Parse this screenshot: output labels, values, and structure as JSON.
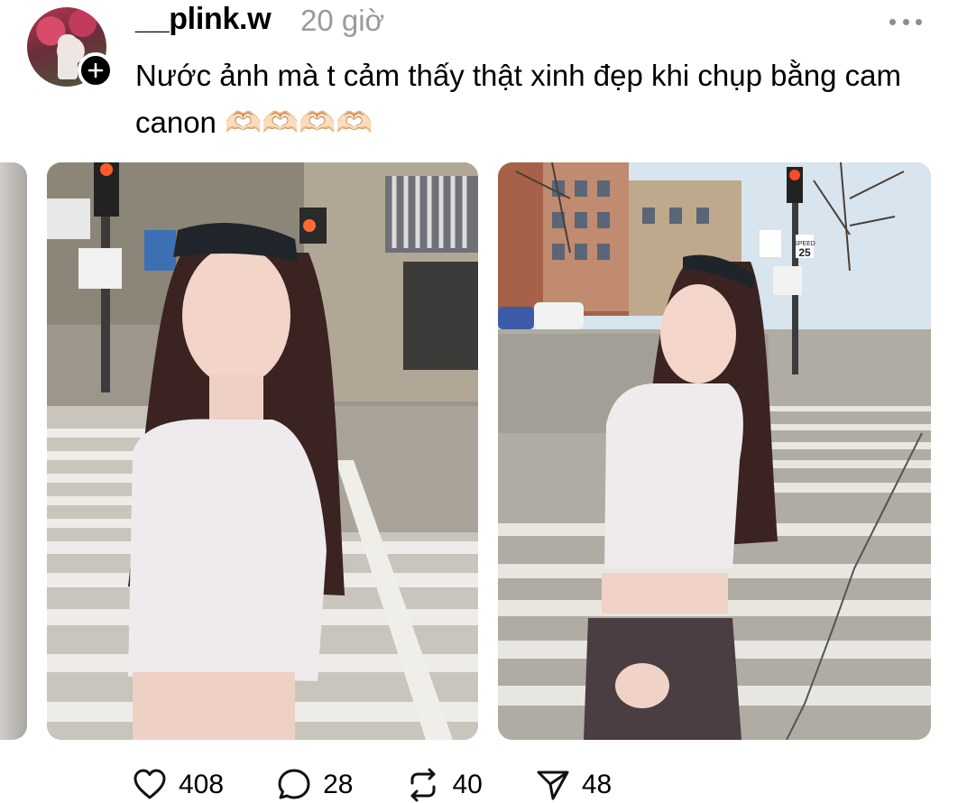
{
  "post": {
    "username": "__plink.w",
    "time": "20 giờ",
    "caption": "Nước ảnh mà t cảm thấy thật xinh đẹp khi chụp bằng cam canon 🫶🏻🫶🏻🫶🏻🫶🏻"
  },
  "icons": {
    "avatar": "avatar",
    "follow": "plus-icon",
    "more": "more-horizontal-icon",
    "like": "heart-icon",
    "comment": "comment-icon",
    "repost": "repost-icon",
    "share": "send-icon"
  },
  "photo_signs": {
    "speed_top": "SPEED",
    "speed_number": "25"
  },
  "stats": {
    "likes": "408",
    "comments": "28",
    "reposts": "40",
    "shares": "48"
  },
  "colors": {
    "accent": "#000000",
    "meta": "#9a9a9a"
  }
}
